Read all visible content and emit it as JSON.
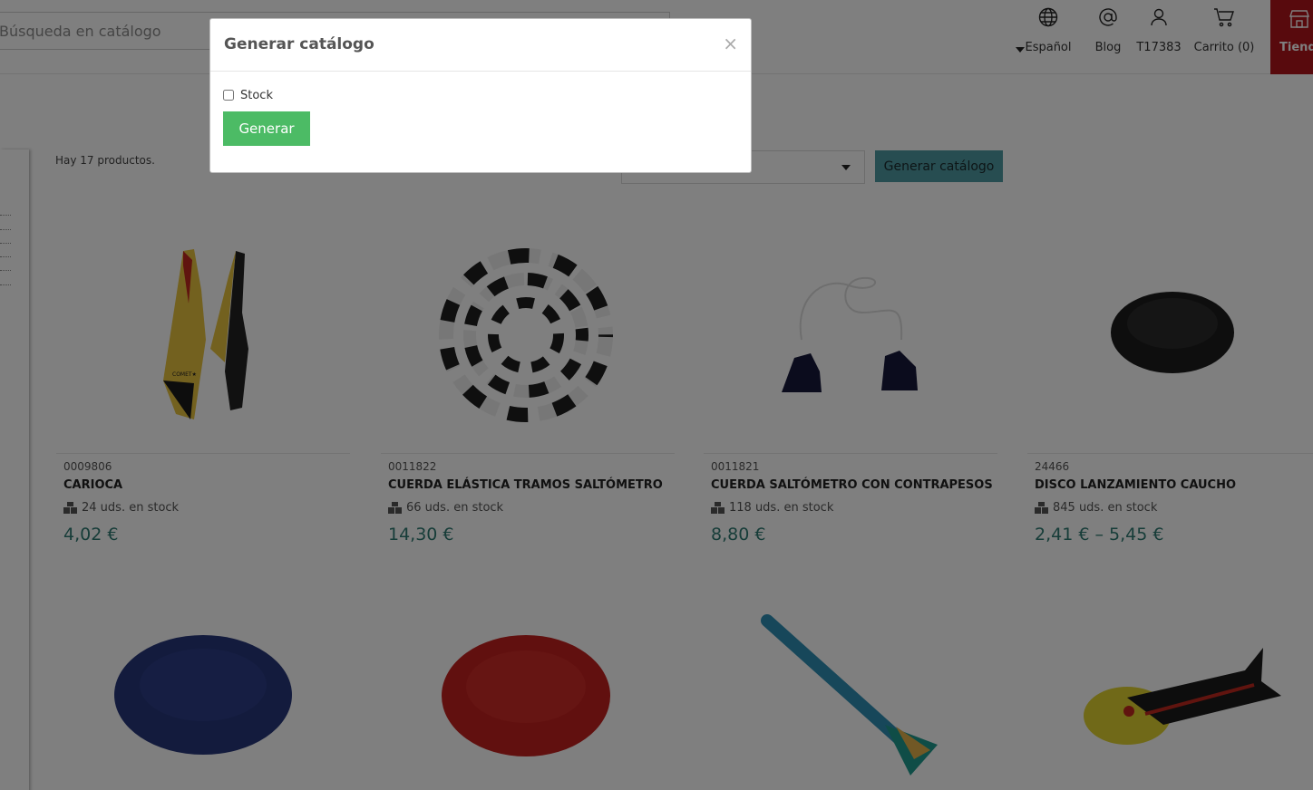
{
  "header": {
    "search_placeholder": "Búsqueda en catálogo",
    "nav": {
      "language": "Español",
      "blog": "Blog",
      "account": "T17383",
      "cart": "Carrito (0)",
      "store": "Tienda"
    }
  },
  "listing": {
    "count_text": "Hay 17 productos.",
    "generate_button": "Generar catálogo"
  },
  "products": [
    {
      "ref": "0009806",
      "name": "CARIOCA",
      "stock": "24 uds. en stock",
      "price": "4,02 €"
    },
    {
      "ref": "0011822",
      "name": "CUERDA ELÁSTICA TRAMOS SALTÓMETRO",
      "stock": "66 uds. en stock",
      "price": "14,30 €"
    },
    {
      "ref": "0011821",
      "name": "CUERDA SALTÓMETRO CON CONTRAPESOS",
      "stock": "118 uds. en stock",
      "price": "8,80 €"
    },
    {
      "ref": "24466",
      "name": "DISCO LANZAMIENTO CAUCHO",
      "stock": "845 uds. en stock",
      "price": "2,41 € – 5,45 €"
    }
  ],
  "modal": {
    "title": "Generar catálogo",
    "close": "×",
    "stock_label": "Stock",
    "stock_checked": false,
    "submit": "Generar"
  },
  "colors": {
    "store_red": "#b0151b",
    "price_teal": "#2f7a72",
    "generate_green": "#4cbb65",
    "catalog_button": "#4f9aa3"
  }
}
